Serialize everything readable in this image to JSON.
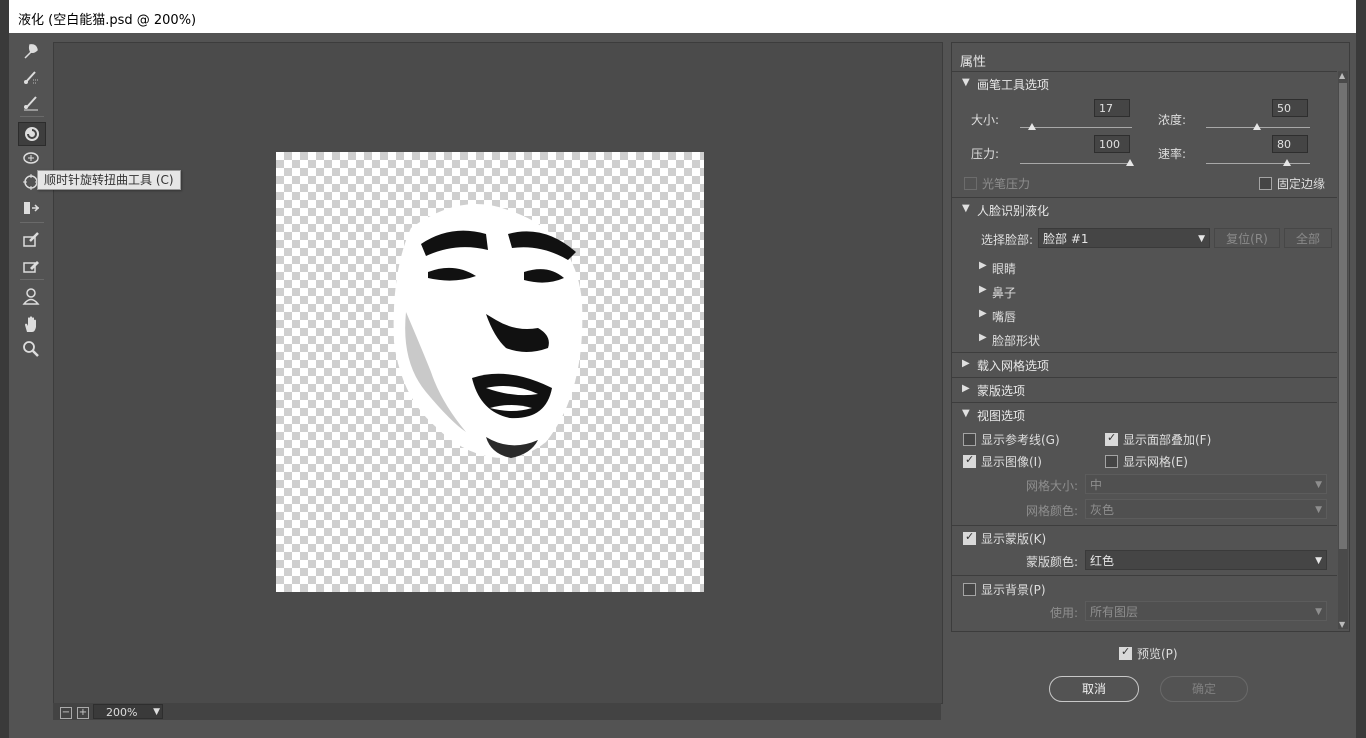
{
  "window": {
    "title": "液化 (空白能猫.psd @ 200%)"
  },
  "tools": [
    {
      "name": "forward-warp-tool-icon"
    },
    {
      "name": "reconstruct-tool-icon"
    },
    {
      "name": "smooth-tool-icon"
    },
    {
      "name": "twirl-clockwise-tool-icon",
      "active": true
    },
    {
      "name": "pucker-tool-icon"
    },
    {
      "name": "bloat-tool-icon"
    },
    {
      "name": "push-left-tool-icon"
    },
    {
      "name": "freeze-mask-tool-icon"
    },
    {
      "name": "thaw-mask-tool-icon"
    },
    {
      "name": "face-tool-icon"
    },
    {
      "name": "hand-tool-icon"
    },
    {
      "name": "zoom-tool-icon"
    }
  ],
  "tooltip": "顺时针旋转扭曲工具 (C)",
  "status": {
    "zoom": "200%"
  },
  "panel": {
    "title": "属性",
    "brush": {
      "header": "画笔工具选项",
      "size_label": "大小:",
      "size_value": "17",
      "density_label": "浓度:",
      "density_value": "50",
      "pressure_label": "压力:",
      "pressure_value": "100",
      "rate_label": "速率:",
      "rate_value": "80",
      "stylus_label": "光笔压力",
      "pin_edges_label": "固定边缘"
    },
    "face": {
      "header": "人脸识别液化",
      "select_label": "选择脸部:",
      "select_value": "脸部 #1",
      "reset_btn": "复位(R)",
      "all_btn": "全部",
      "items": [
        "眼睛",
        "鼻子",
        "嘴唇",
        "脸部形状"
      ]
    },
    "load_mesh": "载入网格选项",
    "mask": "蒙版选项",
    "view": {
      "header": "视图选项",
      "show_guides": "显示参考线(G)",
      "show_face_overlay": "显示面部叠加(F)",
      "show_image": "显示图像(I)",
      "show_mesh": "显示网格(E)",
      "mesh_size_label": "网格大小:",
      "mesh_size_value": "中",
      "mesh_color_label": "网格颜色:",
      "mesh_color_value": "灰色",
      "show_mask": "显示蒙版(K)",
      "mask_color_label": "蒙版颜色:",
      "mask_color_value": "红色",
      "show_backdrop": "显示背景(P)",
      "use_label": "使用:",
      "use_value": "所有图层"
    }
  },
  "footer": {
    "preview_label": "预览(P)",
    "cancel": "取消",
    "ok": "确定"
  },
  "colors": {
    "panel_bg": "#535353",
    "canvas_bg": "#4b4b4b",
    "titlebar": "#ffffff"
  }
}
